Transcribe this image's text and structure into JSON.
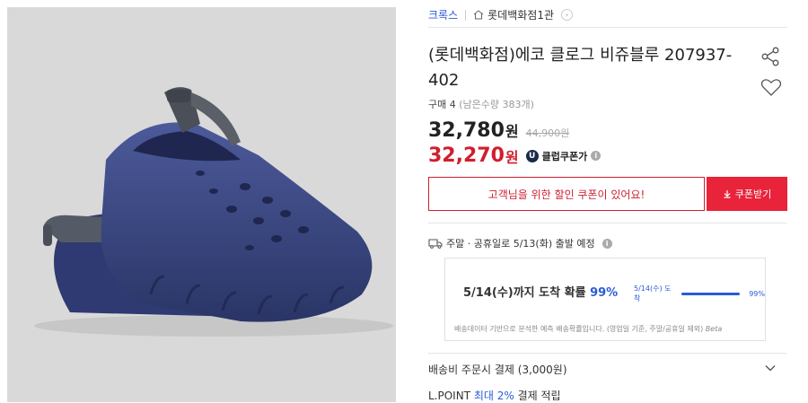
{
  "breadcrumb": {
    "brand": "크록스",
    "store": "롯데백화점1관"
  },
  "product": {
    "title": "(롯데백화점)에코 클로그 비쥬블루 207937-402",
    "purchase_label": "구매 4",
    "remaining": "(남은수량 383개)"
  },
  "price": {
    "sale": "32,780",
    "won": "원",
    "original": "44,900원",
    "club": "32,270",
    "club_badge": "U",
    "club_label": "클럽쿠폰가"
  },
  "coupon": {
    "message": "고객님을 위한 할인 쿠폰이 있어요!",
    "button": "쿠폰받기"
  },
  "shipping": {
    "text": "주말 · 공휴일로 5/13(화) 출발 예정",
    "arrival_text": "5/14(수)까지 도착 확률",
    "arrival_pct": "99%",
    "mini_label": "5/14(수) 도착",
    "mini_pct": "99%",
    "mini_fraction": 0.99,
    "note": "배송데이터 기반으로 분석한 예측 배송확률입니다. (영업일 기준, 주말/공휴일 제외)",
    "note_beta": "Beta"
  },
  "fee": {
    "text": "배송비 주문시 결제 (3,000원)"
  },
  "partial": {
    "a": "L.POINT",
    "b": "최대 2%",
    "c": "결제 적립"
  },
  "colors": {
    "accent_red": "#d01e2e",
    "accent_blue": "#2a5bd7",
    "clog": "#3b4a86"
  },
  "icons": [
    "home-icon",
    "chevron-right-icon",
    "share-icon",
    "heart-icon",
    "info-icon",
    "download-icon",
    "truck-icon",
    "chevron-down-icon"
  ]
}
